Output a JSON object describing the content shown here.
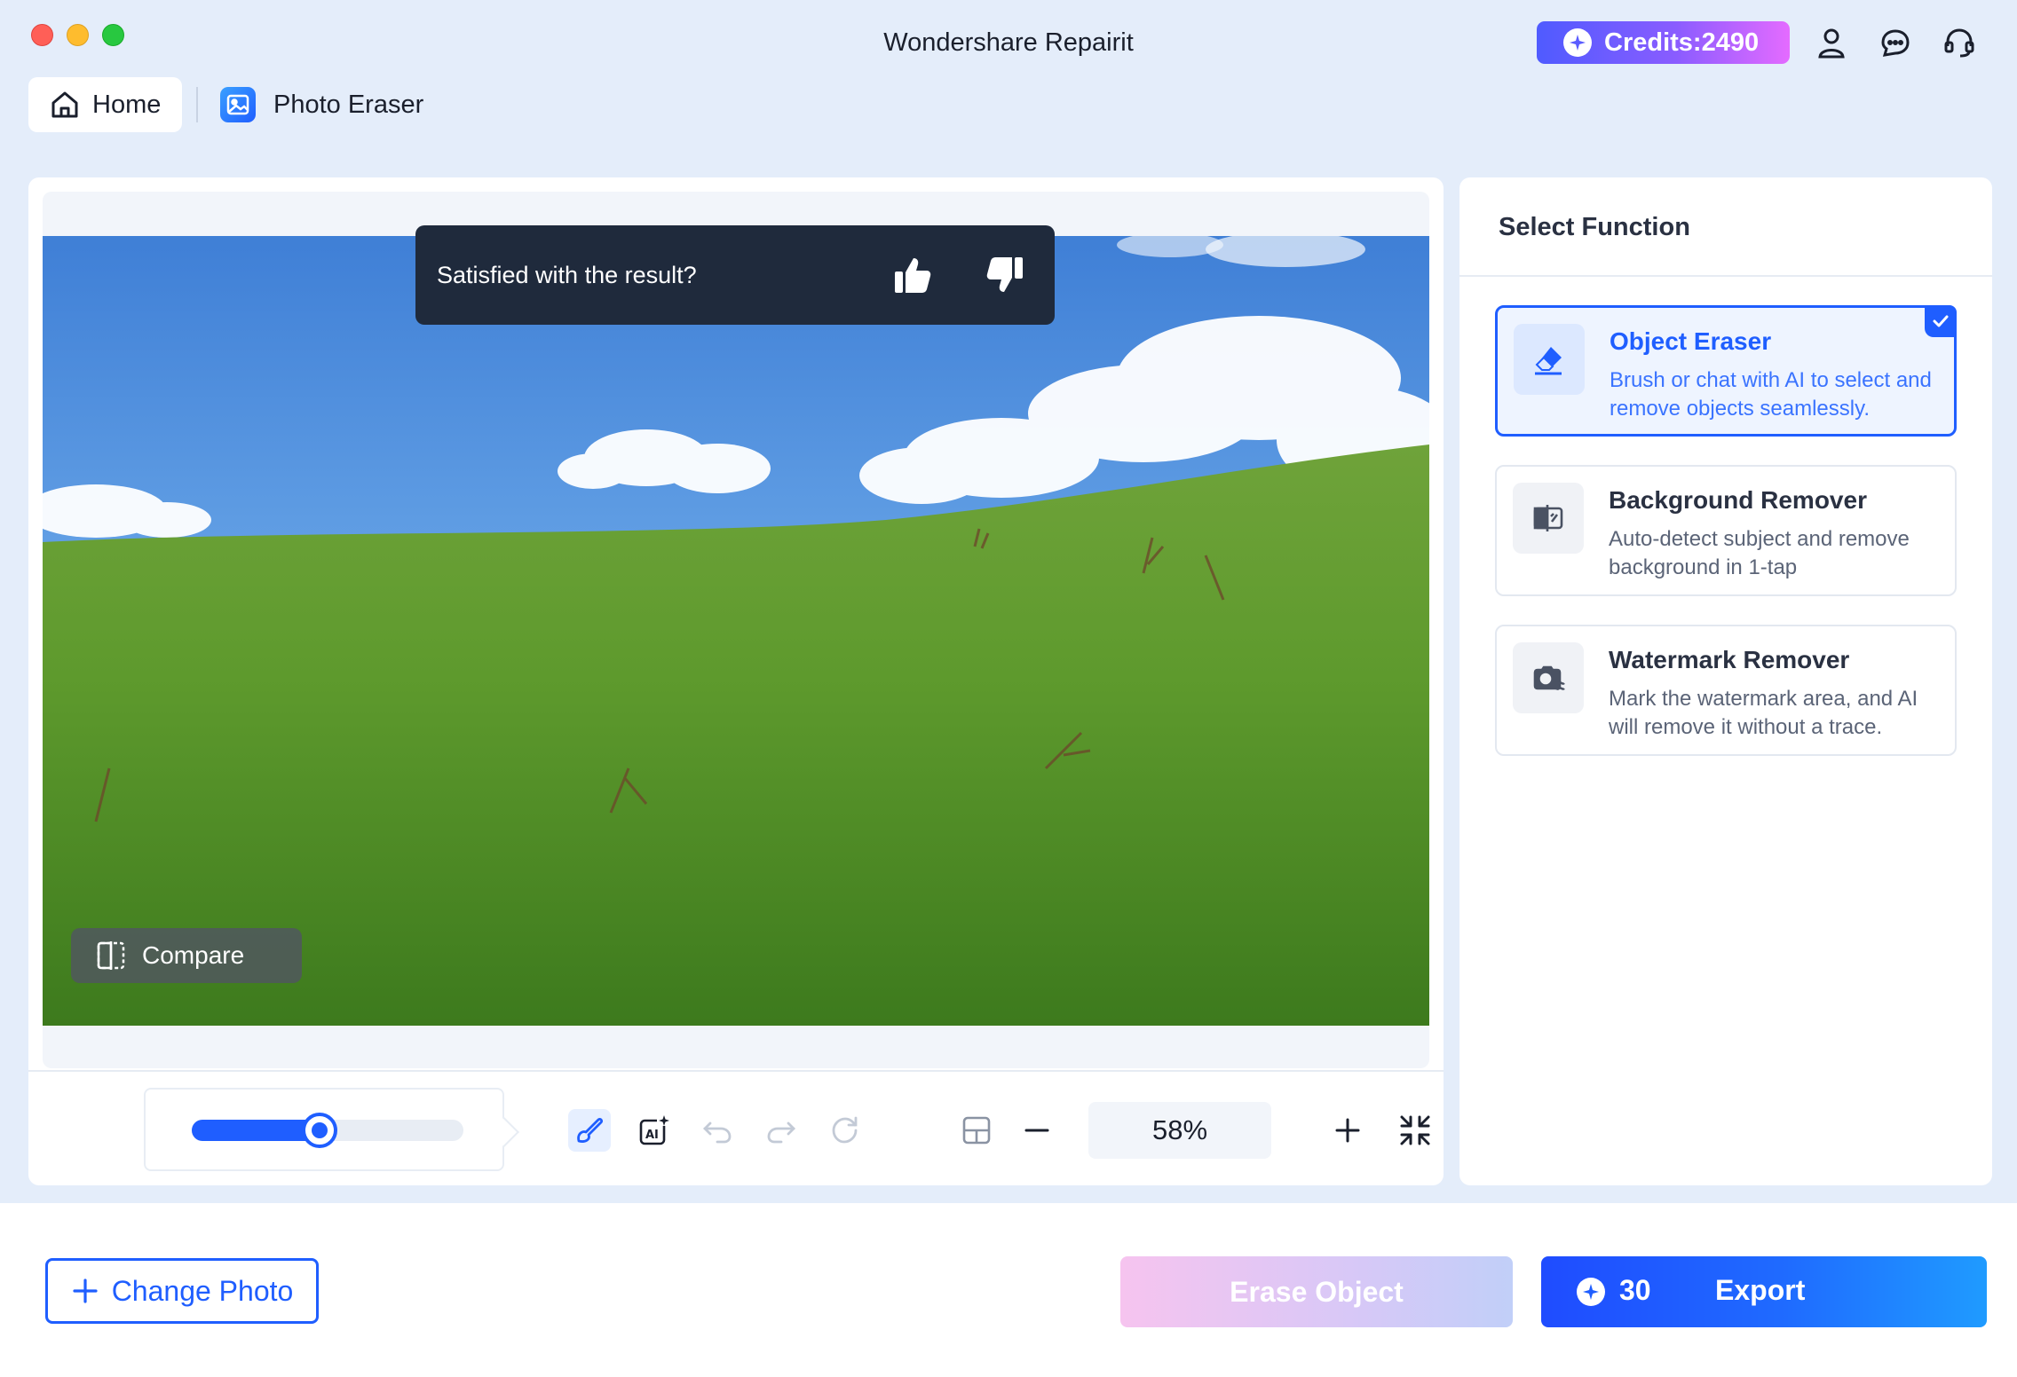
{
  "window": {
    "title": "Wondershare Repairit",
    "credits_label": "Credits:2490"
  },
  "nav": {
    "home_label": "Home",
    "current_label": "Photo Eraser"
  },
  "canvas": {
    "feedback_prompt": "Satisfied with the result?",
    "compare_label": "Compare"
  },
  "toolbar": {
    "brush_size_fraction": 0.47,
    "zoom_value": "58%"
  },
  "side_panel": {
    "title": "Select Function",
    "functions": [
      {
        "name": "Object Eraser",
        "description": "Brush or chat with AI to select and remove objects seamlessly.",
        "selected": true,
        "icon": "eraser-icon"
      },
      {
        "name": "Background Remover",
        "description": "Auto-detect subject and remove background in 1-tap",
        "selected": false,
        "icon": "background-remove-icon"
      },
      {
        "name": "Watermark Remover",
        "description": "Mark the watermark area, and AI will remove it without a trace.",
        "selected": false,
        "icon": "watermark-remove-icon"
      }
    ]
  },
  "bottom": {
    "change_photo_label": "Change Photo",
    "erase_label": "Erase Object",
    "export_cost": "30",
    "export_label": "Export"
  },
  "colors": {
    "accent": "#1f5eff",
    "background": "#e4edfa",
    "feedback_bg": "#1f2a3c"
  }
}
